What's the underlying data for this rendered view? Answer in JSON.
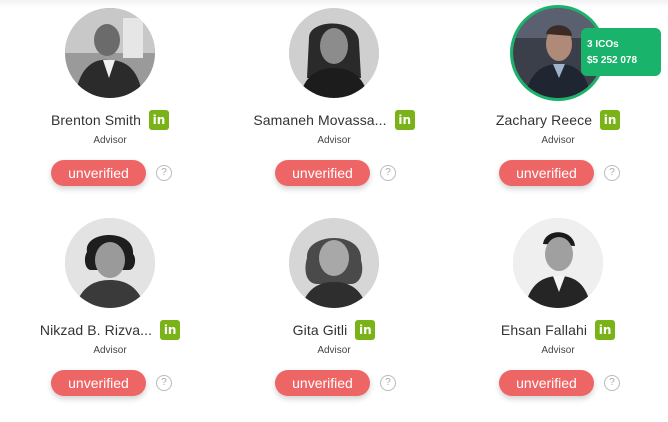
{
  "people": [
    {
      "name": "Brenton Smith",
      "role": "Advisor",
      "status": "unverified",
      "linkedin_icon": "linkedin-icon"
    },
    {
      "name": "Samaneh Movassa...",
      "role": "Advisor",
      "status": "unverified",
      "linkedin_icon": "linkedin-icon"
    },
    {
      "name": "Zachary Reece",
      "role": "Advisor",
      "status": "unverified",
      "linkedin_icon": "linkedin-icon"
    },
    {
      "name": "Nikzad B. Rizva...",
      "role": "Advisor",
      "status": "unverified",
      "linkedin_icon": "linkedin-icon"
    },
    {
      "name": "Gita Gitli",
      "role": "Advisor",
      "status": "unverified",
      "linkedin_icon": "linkedin-icon"
    },
    {
      "name": "Ehsan Fallahi",
      "role": "Advisor",
      "status": "unverified",
      "linkedin_icon": "linkedin-icon"
    }
  ],
  "linkedin_label": "in",
  "help_label": "?",
  "ico_badge": {
    "count": "3 ICOs",
    "amount": "$5 252 078"
  },
  "colors": {
    "linkedin": "#7ab317",
    "unverified": "#ee6566",
    "highlight": "#19b36b"
  }
}
